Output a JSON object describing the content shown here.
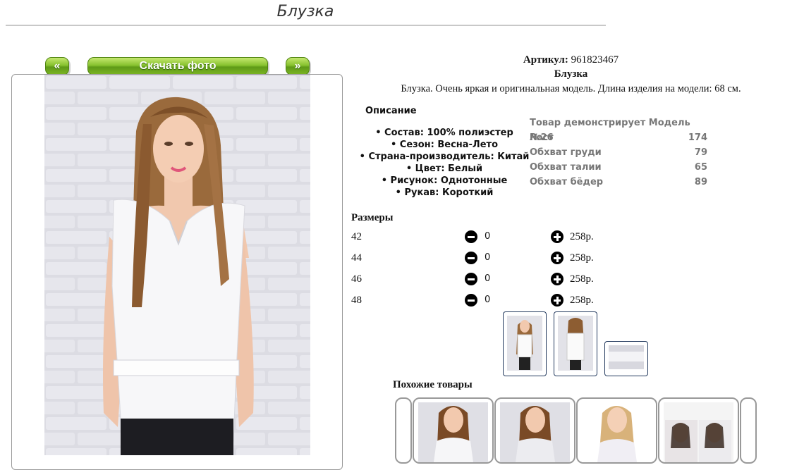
{
  "page": {
    "title": "Блузка"
  },
  "photo_nav": {
    "prev_label": "«",
    "download_label": "Скачать фото",
    "next_label": "»"
  },
  "product": {
    "article_label": "Артикул:",
    "article_value": "961823467",
    "name": "Блузка",
    "short_description": "Блузка. Очень яркая и оригинальная модель. Длина изделия на модели: 68 см."
  },
  "description": {
    "heading": "Описание",
    "items": [
      "• Состав: 100% полиэстер",
      "• Сезон: Весна-Лето",
      "• Страна-производитель: Китай",
      "• Цвет: Белый",
      "• Рисунок: Однотонные",
      "• Рукав: Короткий"
    ]
  },
  "model_info": {
    "heading": "Товар демонстрирует Модель №26",
    "rows": [
      {
        "label": "Рост",
        "value": "174"
      },
      {
        "label": "Обхват груди",
        "value": "79"
      },
      {
        "label": "Обхват талии",
        "value": "65"
      },
      {
        "label": "Обхват бёдер",
        "value": "89"
      }
    ]
  },
  "sizes": {
    "heading": "Размеры",
    "rows": [
      {
        "size": "42",
        "qty": "0",
        "price": "258р."
      },
      {
        "size": "44",
        "qty": "0",
        "price": "258р."
      },
      {
        "size": "46",
        "qty": "0",
        "price": "258р."
      },
      {
        "size": "48",
        "qty": "0",
        "price": "258р."
      }
    ]
  },
  "similar": {
    "heading": "Похожие товары"
  },
  "colors": {
    "button_green": "#86c12e",
    "thumb_border": "#233a5e",
    "wall": "#dcdce2"
  }
}
